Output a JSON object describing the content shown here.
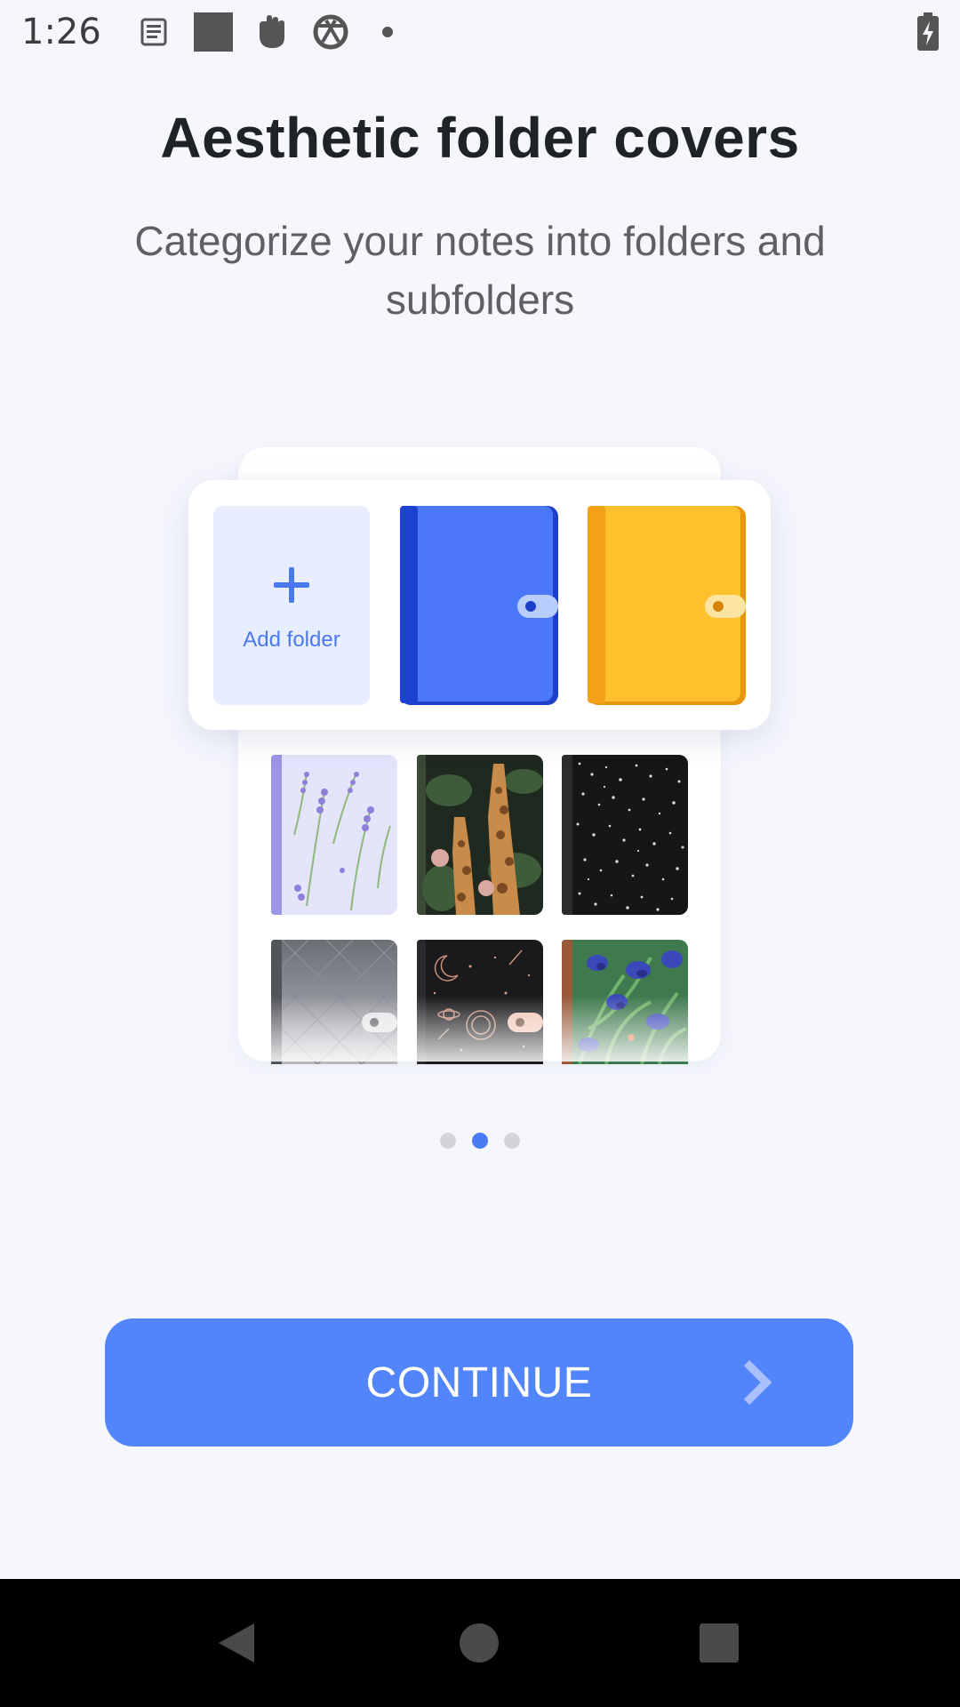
{
  "status_bar": {
    "time": "1:26",
    "icons": [
      "notes-icon",
      "square-icon",
      "fist-icon",
      "ball-icon",
      "dot-icon"
    ],
    "battery_icon": "battery-charging-icon"
  },
  "onboarding": {
    "title": "Aesthetic folder covers",
    "subtitle": "Categorize your notes into folders and subfolders",
    "add_folder_label": "Add folder",
    "folder_covers": [
      "blue-notebook-cover",
      "yellow-notebook-cover",
      "lavender-floral-cover",
      "giraffe-jungle-cover",
      "black-speckled-cover",
      "gray-diamond-cover",
      "celestial-night-cover",
      "iris-painting-cover"
    ],
    "page_indicator": {
      "count": 3,
      "active_index": 1
    },
    "continue_label": "CONTINUE",
    "continue_icon": "chevron-right-icon"
  },
  "colors": {
    "accent": "#5284FA",
    "background": "#F6F7FD",
    "blue_folder": "#4A78F9",
    "yellow_folder": "#FFC02E"
  },
  "nav_bar": {
    "icons": [
      "back-icon",
      "home-icon",
      "recents-icon"
    ]
  }
}
